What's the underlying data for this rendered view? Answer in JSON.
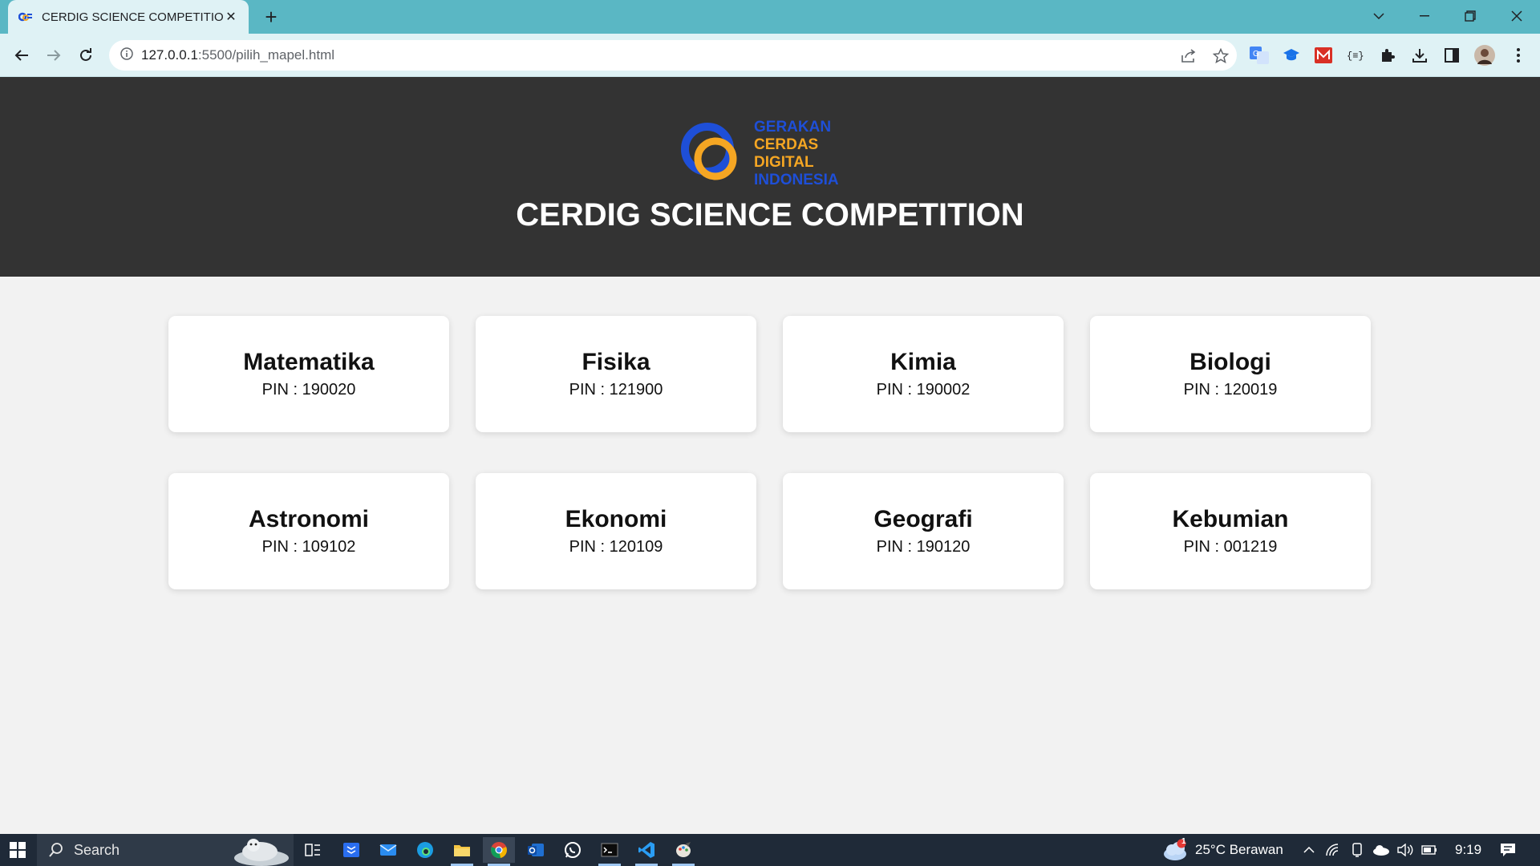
{
  "browser": {
    "tab_title": "CERDIG SCIENCE COMPETITION",
    "tab_close": "✕",
    "new_tab": "+",
    "url_host": "127.0.0.1",
    "url_path": ":5500/pilih_mapel.html"
  },
  "header": {
    "logo_text": [
      "GERAKAN",
      "CERDAS",
      "DIGITAL",
      "INDONESIA"
    ],
    "title": "CERDIG SCIENCE COMPETITION"
  },
  "subjects": [
    {
      "name": "Matematika",
      "pin": "PIN : 190020"
    },
    {
      "name": "Fisika",
      "pin": "PIN : 121900"
    },
    {
      "name": "Kimia",
      "pin": "PIN : 190002"
    },
    {
      "name": "Biologi",
      "pin": "PIN : 120019"
    },
    {
      "name": "Astronomi",
      "pin": "PIN : 109102"
    },
    {
      "name": "Ekonomi",
      "pin": "PIN : 120109"
    },
    {
      "name": "Geografi",
      "pin": "PIN : 190120"
    },
    {
      "name": "Kebumian",
      "pin": "PIN : 001219"
    }
  ],
  "taskbar": {
    "search_placeholder": "Search",
    "weather": "25°C  Berawan",
    "time": "9:19",
    "weather_badge": "1"
  },
  "colors": {
    "tab_strip": "#5ab7c4",
    "toolbar": "#dff2f5",
    "header_bg": "#333333",
    "page_bg": "#f2f2f2",
    "logo_blue": "#1e4fd8",
    "logo_orange": "#f5a623"
  }
}
